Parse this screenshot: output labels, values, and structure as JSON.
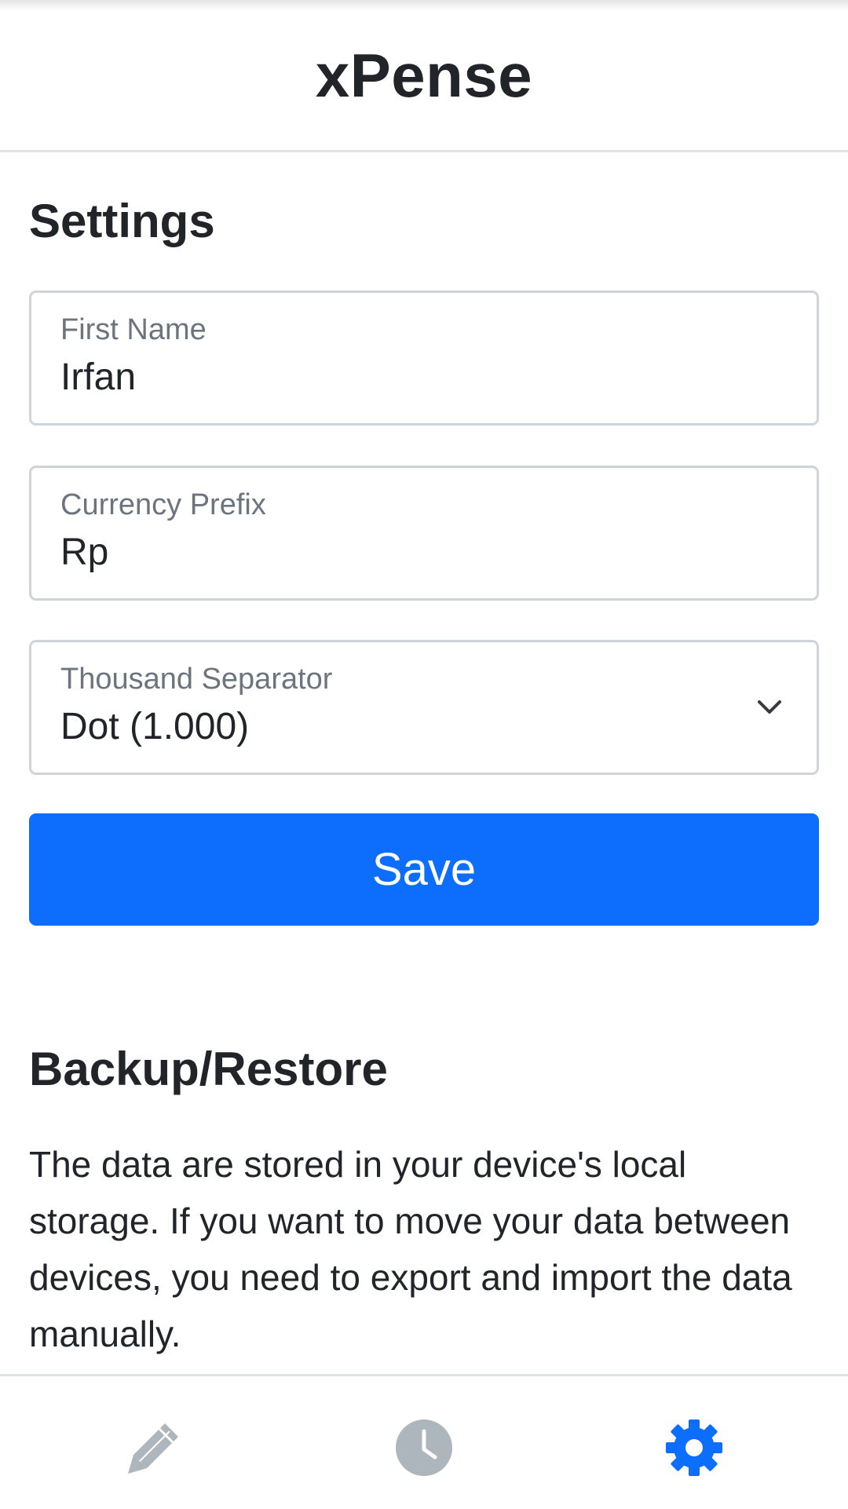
{
  "app": {
    "title": "xPense"
  },
  "settings": {
    "title": "Settings",
    "first_name": {
      "label": "First Name",
      "value": "Irfan"
    },
    "currency_prefix": {
      "label": "Currency Prefix",
      "value": "Rp"
    },
    "thousand_separator": {
      "label": "Thousand Separator",
      "selected": "Dot (1.000)"
    },
    "save_label": "Save"
  },
  "backup": {
    "title": "Backup/Restore",
    "description": "The data are stored in your device's local storage. If you want to move your data between devices, you need to export and import the data manually."
  },
  "nav": {
    "items": [
      {
        "icon": "pencil-icon",
        "active": false
      },
      {
        "icon": "clock-icon",
        "active": false
      },
      {
        "icon": "gear-icon",
        "active": true
      }
    ]
  },
  "colors": {
    "accent": "#0d6efd",
    "inactive_icon": "#adb5bd",
    "text": "#212529",
    "muted": "#6c757d",
    "border": "#ced4da"
  }
}
